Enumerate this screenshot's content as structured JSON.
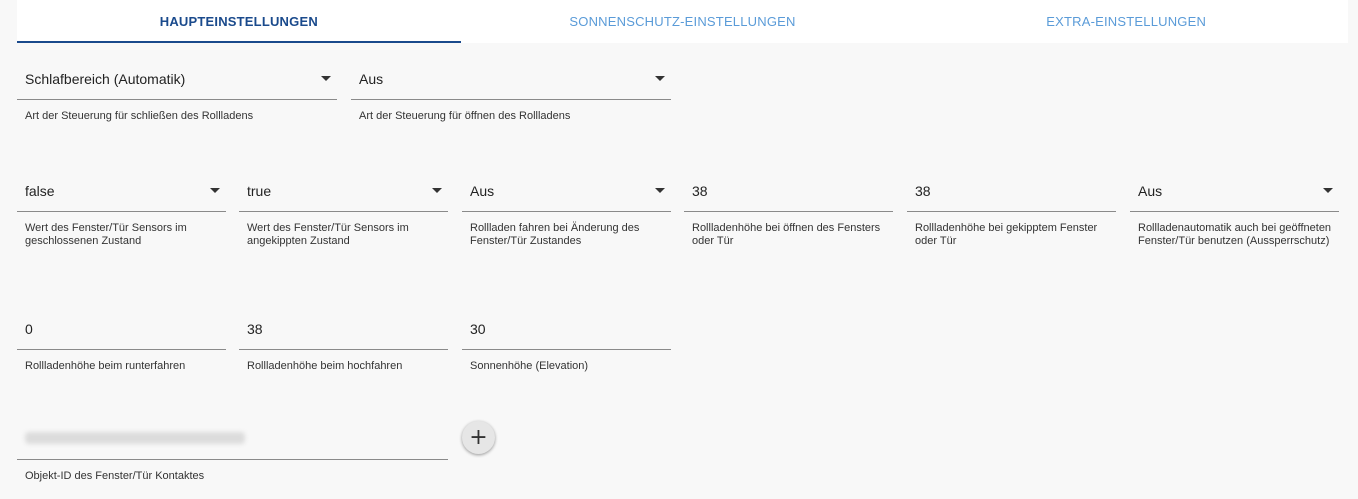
{
  "tabs": [
    {
      "label": "HAUPTEINSTELLUNGEN",
      "active": true
    },
    {
      "label": "SONNENSCHUTZ-EINSTELLUNGEN",
      "active": false
    },
    {
      "label": "EXTRA-EINSTELLUNGEN",
      "active": false
    }
  ],
  "row1": [
    {
      "value": "Schlafbereich (Automatik)",
      "help": "Art der Steuerung für schließen des Rollladens"
    },
    {
      "value": "Aus",
      "help": "Art der Steuerung für öffnen des Rollladens"
    }
  ],
  "row2": [
    {
      "value": "false",
      "help": "Wert des Fenster/Tür Sensors im geschlossenen Zustand"
    },
    {
      "value": "true",
      "help": "Wert des Fenster/Tür Sensors im angekippten Zustand"
    },
    {
      "value": "Aus",
      "help": "Rollladen fahren bei Änderung des Fenster/Tür Zustandes"
    },
    {
      "value": "38",
      "help": "Rollladenhöhe bei öffnen des Fensters oder Tür"
    },
    {
      "value": "38",
      "help": "Rollladenhöhe bei gekipptem Fenster oder Tür"
    },
    {
      "value": "Aus",
      "help": "Rollladenautomatik auch bei geöffneten Fenster/Tür benutzen (Aussperrschutz)"
    }
  ],
  "row3": [
    {
      "value": "0",
      "help": "Rollladenhöhe beim runterfahren"
    },
    {
      "value": "38",
      "help": "Rollladenhöhe beim hochfahren"
    },
    {
      "value": "30",
      "help": "Sonnenhöhe (Elevation)"
    }
  ],
  "contact": {
    "help": "Objekt-ID des Fenster/Tür Kontaktes",
    "add_icon": "plus-icon",
    "add_symbol": "+"
  }
}
